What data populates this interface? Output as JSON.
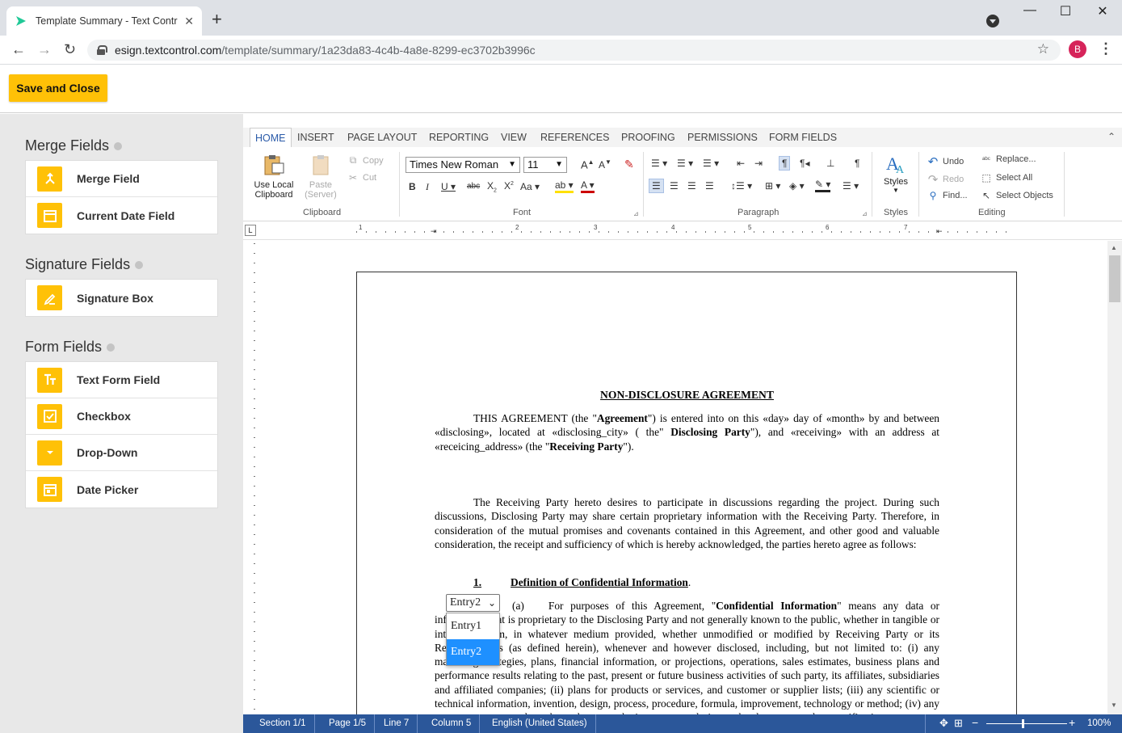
{
  "browser": {
    "tab_title": "Template Summary - Text Control",
    "tab_close": "✕",
    "new_tab": "+",
    "url_host": "esign.textcontrol.com",
    "url_path": "/template/summary/1a23da83-4c4b-4a8e-8299-ec3702b3996c",
    "profile_initial": "B",
    "win_min": "—",
    "win_max": "☐",
    "win_close": "✕",
    "back": "←",
    "forward": "→",
    "reload": "↻",
    "star": "☆",
    "menu": "⋮"
  },
  "header": {
    "save_close": "Save and Close"
  },
  "sidebar": {
    "merge_title": "Merge Fields",
    "merge_items": [
      "Merge Field",
      "Current Date Field"
    ],
    "signature_title": "Signature Fields",
    "signature_items": [
      "Signature Box"
    ],
    "form_title": "Form Fields",
    "form_items": [
      "Text Form Field",
      "Checkbox",
      "Drop-Down",
      "Date Picker"
    ]
  },
  "ribbon": {
    "tabs": [
      "HOME",
      "INSERT",
      "PAGE LAYOUT",
      "REPORTING",
      "VIEW",
      "REFERENCES",
      "PROOFING",
      "PERMISSIONS",
      "FORM FIELDS"
    ],
    "collapse": "⌃",
    "clipboard": {
      "use_local_1": "Use Local",
      "use_local_2": "Clipboard",
      "paste_1": "Paste",
      "paste_2": "(Server)",
      "copy": "Copy",
      "cut": "Cut",
      "label": "Clipboard"
    },
    "font": {
      "name": "Times New Roman",
      "size": "11",
      "label": "Font"
    },
    "paragraph": {
      "label": "Paragraph"
    },
    "styles": {
      "button": "Styles",
      "label": "Styles"
    },
    "editing": {
      "undo": "Undo",
      "redo": "Redo",
      "find": "Find...",
      "replace": "Replace...",
      "select_all": "Select All",
      "select_objects": "Select Objects",
      "label": "Editing"
    }
  },
  "ruler": {
    "corner": "L",
    "numbers": [
      "1",
      "2",
      "3",
      "4",
      "5",
      "6",
      "7"
    ]
  },
  "document": {
    "title": "NON-DISCLOSURE AGREEMENT",
    "p1_a": "THIS AGREEMENT (the \"",
    "p1_b": "Agreement",
    "p1_c": "\") is entered into on this «day» day of «month» by and between «disclosing», located at «disclosing_city» ( the\" ",
    "p1_d": "Disclosing Party",
    "p1_e": "\"), and «receiving» with an address at «receicing_address» (the \"",
    "p1_f": "Receiving Party",
    "p1_g": "\").",
    "p2": "The Receiving Party hereto desires to participate in discussions regarding the project.  During such discussions, Disclosing Party may share certain proprietary information with the Receiving Party. Therefore, in consideration of the mutual promises and covenants contained in this Agreement, and other good and valuable consideration, the receipt and sufficiency of which is hereby acknowledged, the parties hereto agree as follows:",
    "s1_num": "1.",
    "s1_title": "Definition of Confidential Information",
    "s1_dot": ".",
    "s1a_label": "(a)",
    "s1a_pre": "For purposes of this Agreement, \"",
    "s1a_bold": "Confidential Information",
    "s1a_post": "\" means any data or information that is proprietary to the Disclosing Party and not generally known to the public, whether in tangible or intangible form, in whatever medium provided, whether unmodified or modified by Receiving Party or its Representatives (as defined herein), whenever and however disclosed, including, but not limited to: (i) any marketing strategies, plans, financial information, or projections, operations, sales estimates, business plans and performance results relating to the past, present or future business activities of such party, its affiliates, subsidiaries and affiliated companies; (ii) plans for products or services, and customer or supplier lists; (iii) any scientific or technical information, invention, design, process, procedure, formula, improvement, technology or method; (iv) any concepts, reports, data, know-how, works-in-progress, designs, development tools, specifications, computer software, source code, object code, flow charts, databases, inventions, information and trade secrets."
  },
  "dropdown": {
    "selected": "Entry2",
    "options": [
      "Entry1",
      "Entry2"
    ],
    "chevron": "⌄"
  },
  "status": {
    "section": "Section 1/1",
    "page": "Page 1/5",
    "line": "Line 7",
    "column": "Column 5",
    "language": "English (United States)",
    "zoom_minus": "−",
    "zoom_plus": "+",
    "zoom": "100%",
    "zoom_level": 1.0
  }
}
